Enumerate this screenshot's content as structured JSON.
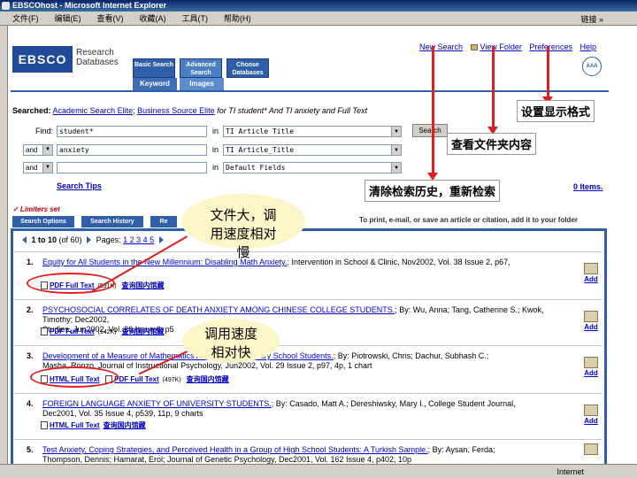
{
  "window": {
    "title": "EBSCOhost - Microsoft Internet Explorer",
    "menu": [
      "文件(F)",
      "编辑(E)",
      "查看(V)",
      "收藏(A)",
      "工具(T)",
      "帮助(H)"
    ],
    "links_label": "链接 »",
    "status": "Internet"
  },
  "header": {
    "logo": "EBSCO",
    "logo_sub": "Research Databases",
    "tabs": [
      "Basic Search",
      "Advanced Search",
      "Choose Databases"
    ],
    "subtabs": [
      "Keyword",
      "Images"
    ],
    "top_links": {
      "new_search": "New Search",
      "view_folder": "View Folder",
      "preferences": "Preferences",
      "help": "Help"
    },
    "badge": "AAA"
  },
  "searched": {
    "label": "Searched:",
    "db1": "Academic Search Elite",
    "sep": ";",
    "db2": "Business Source Elite",
    "query": "for TI student* And TI anxiety and Full Text"
  },
  "find": {
    "find_label": "Find:",
    "in_label": "in",
    "rows": [
      {
        "bool": "",
        "term": "student*",
        "field": "TI Article Title"
      },
      {
        "bool": "and",
        "term": "anxiety",
        "field": "TI Article_Title"
      },
      {
        "bool": "and",
        "term": "",
        "field": "Default Fields"
      }
    ],
    "search_button": "Search",
    "search_tips": "Search Tips",
    "items_link": "0 Items."
  },
  "results": {
    "limiters": "✓ Limiters set",
    "tabs": [
      "Search Options",
      "Search History",
      "Re"
    ],
    "print_note": "To print, e-mail, or save an article or citation, add it to your folder",
    "pager": {
      "range": "1 to 10",
      "of": "(of 60)",
      "pages_label": "Pages:",
      "pages": "1 2 3 4 5"
    },
    "items": [
      {
        "num": "1.",
        "title": "Equity for All Students in the New Millennium: Disabling Math Anxiety.",
        "meta": "; Intervention in School & Clinic, Nov2002, Vol. 38 Issue 2, p67,",
        "meta2": "",
        "links": [
          {
            "label": "PDF Full Text",
            "size": "(591K)"
          }
        ],
        "lib": "查询国内馆藏",
        "add": "Add"
      },
      {
        "num": "2.",
        "title": "PSYCHOSOCIAL CORRELATES OF DEATH ANXIETY AMONG CHINESE COLLEGE STUDENTS.",
        "meta": "; By: Wu, Anna; Tang, Catherine S.; Kwok, Timothy; Dec2002,",
        "meta2": "Studies, Jun2002, Vol. 26 Issue 6, p5",
        "links": [
          {
            "label": "PDF Full Text",
            "size": "(142K)"
          }
        ],
        "lib": "查询国内馆藏",
        "add": "Add"
      },
      {
        "num": "3.",
        "title": "Development of a Measure of Mathematics Anxiety in Secondary School Students.",
        "meta": "; By: Piotrowski, Chris; Dachur, Subhash C.;",
        "meta2": "Masha, Ronzo, Journal of Instructional Psychology, Jun2002, Vol. 29 Issue 2, p97, 4p, 1 chart",
        "links": [
          {
            "label": "HTML Full Text",
            "size": ""
          },
          {
            "label": "PDF Full Text",
            "size": "(497K)"
          }
        ],
        "lib": "查询国内馆藏",
        "add": "Add"
      },
      {
        "num": "4.",
        "title": "FOREIGN LANGUAGE ANXIETY OF UNIVERSITY STUDENTS.",
        "meta": "; By: Casado, Matt A.; Dereshiwsky, Mary I., College Student Journal,",
        "meta2": "Dec2001, Vol. 35 Issue 4, p539, 11p, 9 charts",
        "links": [
          {
            "label": "HTML Full Text",
            "size": ""
          }
        ],
        "lib": "查询国内馆藏",
        "add": "Add"
      },
      {
        "num": "5.",
        "title": "Test Anxiety, Coping Strategies, and Perceived Health in a Group of High School Students: A Turkish Sample.",
        "meta": "; By: Aysan, Ferda;",
        "meta2": "Thompson, Dennis; Hamarat, Erol; Journal of Genetic Psychology, Dec2001, Vol. 162 Issue 4, p402, 10p",
        "links": [],
        "lib": "",
        "add": "Add"
      }
    ]
  },
  "annotations": {
    "preferences_note": "设置显示格式",
    "folder_note": "查看文件夹内容",
    "new_search_note": "清除检索历史，重新检索",
    "pdf_note": "文件大，调用速度相对慢",
    "html_note": "调用速度相对快"
  },
  "colors": {
    "brand_blue": "#2e5fa8",
    "annotation_red": "#e02020",
    "bubble_yellow": "#fbf6c8",
    "link_blue": "#0000cc"
  }
}
